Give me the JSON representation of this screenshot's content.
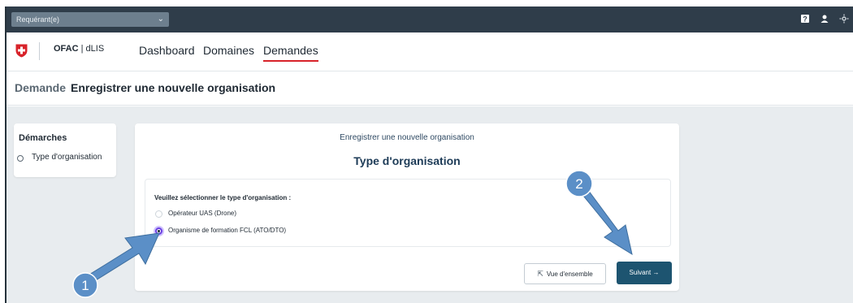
{
  "topbar": {
    "role_select": "Requérant(e)"
  },
  "header": {
    "brand_bold": "OFAC",
    "brand_sep": " | ",
    "brand_rest": "dLIS",
    "nav": [
      "Dashboard",
      "Domaines",
      "Demandes"
    ],
    "active_nav": "Demandes"
  },
  "page": {
    "label": "Demande",
    "title": "Enregistrer une nouvelle organisation"
  },
  "steps": {
    "title": "Démarches",
    "items": [
      "Type d'organisation"
    ]
  },
  "form": {
    "subtitle": "Enregistrer une nouvelle organisation",
    "heading": "Type d'organisation",
    "question": "Veuillez sélectionner le type d'organisation :",
    "options": [
      "Opérateur UAS (Drone)",
      "Organisme de formation FCL (ATO/DTO)"
    ],
    "selected": "Organisme de formation FCL (ATO/DTO)"
  },
  "buttons": {
    "overview": "Vue d'ensemble",
    "next": "Suivant →"
  },
  "annotations": {
    "badge_1": "1",
    "badge_2": "2"
  },
  "colors": {
    "topbar": "#2f3d4a",
    "accent_red": "#d8232a",
    "primary_button": "#1d5470",
    "radio_selected": "#6b3fe0",
    "arrow": "#5b8fc7"
  },
  "icons": [
    "chevron-down-icon",
    "help-icon",
    "user-icon",
    "settings-icon",
    "swiss-shield-icon",
    "overview-icon"
  ]
}
